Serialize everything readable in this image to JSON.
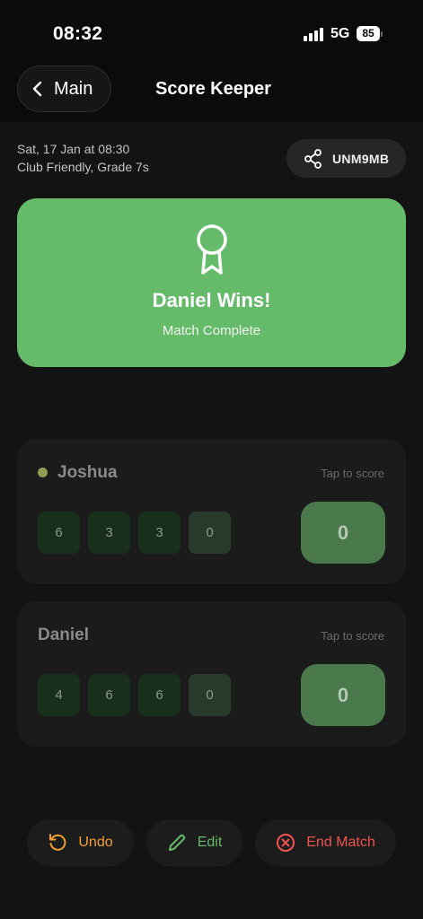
{
  "status_bar": {
    "time": "08:32",
    "network": "5G",
    "battery": "85"
  },
  "header": {
    "back_label": "Main",
    "title": "Score Keeper"
  },
  "match": {
    "date": "Sat, 17 Jan at 08:30",
    "description": "Club Friendly, Grade 7s",
    "share_code": "UNM9MB"
  },
  "banner": {
    "title": "Daniel Wins!",
    "subtitle": "Match Complete",
    "icon": "award-icon"
  },
  "players": [
    {
      "name": "Joshua",
      "serving": true,
      "hint": "Tap to score",
      "ends": [
        "6",
        "3",
        "3",
        "0"
      ],
      "total": "0"
    },
    {
      "name": "Daniel",
      "serving": false,
      "hint": "Tap to score",
      "ends": [
        "4",
        "6",
        "6",
        "0"
      ],
      "total": "0"
    }
  ],
  "actions": {
    "undo": "Undo",
    "edit": "Edit",
    "end_match": "End Match"
  },
  "colors": {
    "accent_green": "#66bb6a",
    "undo": "#f0a02e",
    "danger": "#ef5350",
    "serve_dot": "#8f9d55"
  }
}
